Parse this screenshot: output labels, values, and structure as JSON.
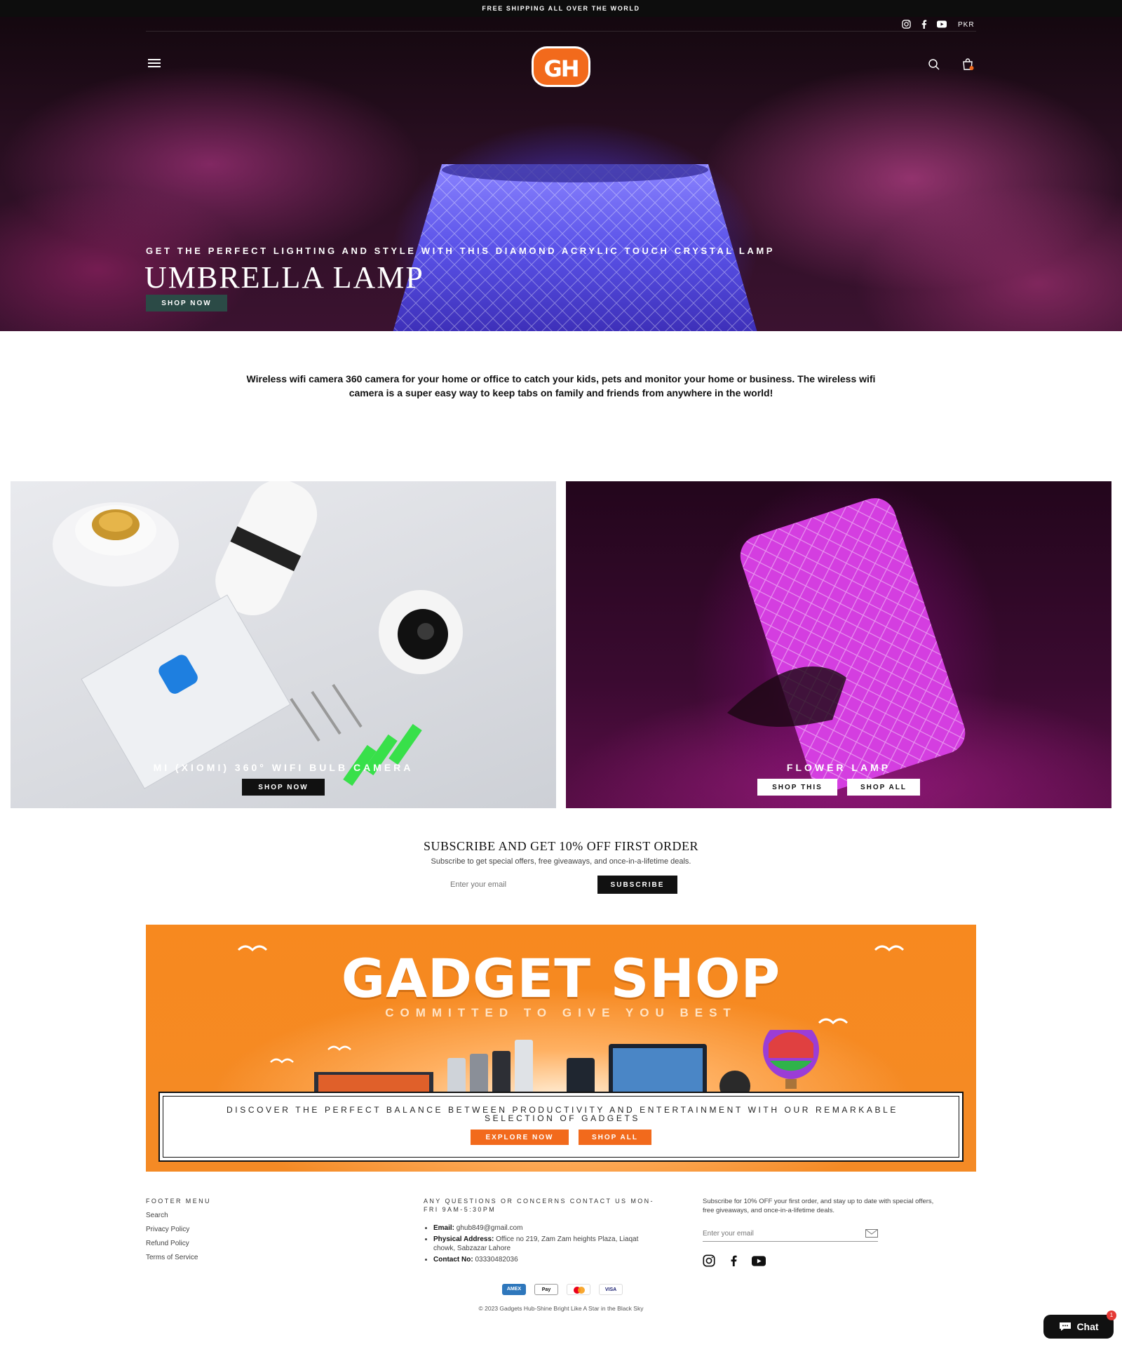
{
  "announcement": "FREE SHIPPING ALL OVER THE WORLD",
  "header": {
    "currency": "PKR",
    "logo_text": "GH",
    "social_icons": [
      "instagram-icon",
      "facebook-icon",
      "youtube-icon"
    ]
  },
  "hero": {
    "subtitle": "GET THE PERFECT LIGHTING AND STYLE WITH THIS DIAMOND ACRYLIC TOUCH CRYSTAL LAMP",
    "title": "UMBRELLA LAMP",
    "button": "SHOP NOW"
  },
  "intro": "Wireless wifi camera 360 camera for your home or office to catch your kids, pets and monitor your home or business. The wireless wifi camera is a super easy way to keep tabs on family and friends from anywhere in the world!",
  "promos": [
    {
      "caption": "MI (XIOMI) 360° WIFI BULB CAMERA",
      "buttons": [
        "SHOP NOW"
      ]
    },
    {
      "caption": "FLOWER LAMP",
      "buttons": [
        "SHOP THIS",
        "SHOP ALL"
      ]
    }
  ],
  "subscribe": {
    "title": "SUBSCRIBE AND GET 10% OFF FIRST ORDER",
    "text": "Subscribe to get special offers, free giveaways, and once-in-a-lifetime deals.",
    "placeholder": "Enter your email",
    "button": "SUBSCRIBE"
  },
  "banner": {
    "title": "GADGET SHOP",
    "tagline": "COMMITTED TO GIVE YOU BEST",
    "text": "DISCOVER THE PERFECT BALANCE BETWEEN PRODUCTIVITY AND ENTERTAINMENT WITH OUR REMARKABLE SELECTION OF GADGETS",
    "buttons": [
      "EXPLORE NOW",
      "SHOP ALL"
    ]
  },
  "footer": {
    "menu_heading": "FOOTER MENU",
    "menu_links": [
      "Search",
      "Privacy Policy",
      "Refund Policy",
      "Terms of Service"
    ],
    "contact_heading": "ANY QUESTIONS OR CONCERNS CONTACT US MON-FRI 9AM-5:30PM",
    "contact": [
      {
        "label": "Email:",
        "value": "ghub849@gmail.com"
      },
      {
        "label": "Physical Address:",
        "value": "Office no 219, Zam Zam heights Plaza, Liaqat chowk, Sabzazar Lahore"
      },
      {
        "label": "Contact No:",
        "value": "03330482036"
      }
    ],
    "newsletter_text": "Subscribe for 10% OFF your first order, and stay up to date with special offers, free giveaways, and once-in-a-lifetime deals.",
    "newsletter_placeholder": "Enter your email",
    "payments": [
      "AMEX",
      "Pay",
      "MC",
      "VISA"
    ],
    "copyright": "© 2023 Gadgets Hub-Shine Bright Like A Star in the Black Sky"
  },
  "chat": {
    "label": "Chat",
    "badge": "1"
  },
  "colors": {
    "brand_orange": "#f26a1c",
    "hero_button": "#2b4a46",
    "dark": "#111111"
  }
}
